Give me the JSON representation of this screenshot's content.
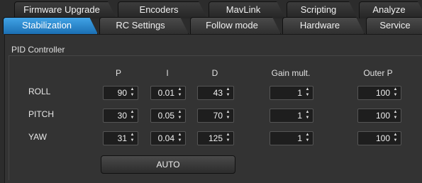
{
  "tabs_back": [
    {
      "label": "Firmware Upgrade"
    },
    {
      "label": "Encoders"
    },
    {
      "label": "MavLink"
    },
    {
      "label": "Scripting"
    },
    {
      "label": "Analyze"
    }
  ],
  "tabs_front": [
    {
      "label": "Stabilization",
      "active": true
    },
    {
      "label": "RC Settings"
    },
    {
      "label": "Follow mode"
    },
    {
      "label": "Hardware"
    },
    {
      "label": "Service"
    }
  ],
  "pid": {
    "title": "PID Controller",
    "columns": [
      "P",
      "I",
      "D",
      "Gain mult.",
      "Outer P"
    ],
    "rows": [
      {
        "label": "ROLL",
        "values": [
          "90",
          "0.01",
          "43",
          "1",
          "100"
        ]
      },
      {
        "label": "PITCH",
        "values": [
          "30",
          "0.05",
          "70",
          "1",
          "100"
        ]
      },
      {
        "label": "YAW",
        "values": [
          "31",
          "0.04",
          "125",
          "1",
          "100"
        ]
      }
    ],
    "auto_label": "AUTO"
  },
  "colors": {
    "active_tab": "#2b8ad4",
    "background": "#2c2c2c"
  },
  "icons": {
    "spin_up": "▲",
    "spin_down": "▼"
  }
}
